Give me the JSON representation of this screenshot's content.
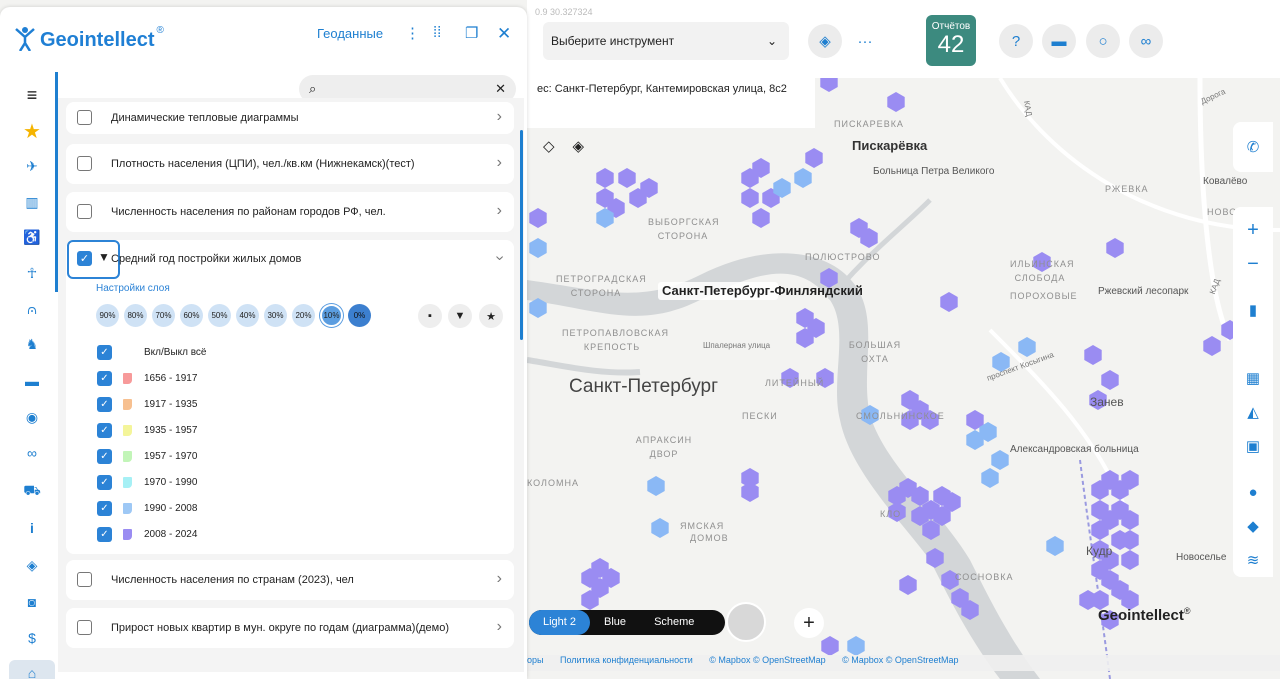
{
  "app": {
    "name": "Geointellect",
    "reg": "®",
    "geodata_label": "Геоданные"
  },
  "colors": {
    "accent": "#1e7fd0",
    "hex_purple": "#9a8cf2",
    "hex_blue": "#8ab8f5",
    "reports_bg": "#3c8a7f"
  },
  "map": {
    "coords_text": "0.9 30.327324",
    "tool_select": "Выберите инструмент",
    "address": "ес: Санкт-Петербург, Кантемировская улица, 8с2",
    "reports_label": "Отчётов",
    "reports_count": "42",
    "labels": {
      "piskarevka_upper": "ПИСКАРЕВКА",
      "piskarevka": "Пискарёвка",
      "hospital": "Больница Петра Великого",
      "kovalevo": "Ковалёво",
      "rzhevka": "РЖЕВКА",
      "novoe": "НОВОЕ",
      "vyborg_side": "ВЫБОРГСКАЯ СТОРОНА",
      "polyustrovo": "ПОЛЮСТРОВО",
      "ilinskaya": "ИЛЬИНСКАЯ СЛОБОДА",
      "porokhovye": "ПОРОХОВЫЕ",
      "rzhevsky_park": "Ржевский лесопарк",
      "petrograd": "ПЕТРОГРАДСКАЯ СТОРОНА",
      "station": "Санкт-Петербург-Финляндский",
      "bolshaya_okhta": "БОЛЬШАЯ ОХТА",
      "shpalernaya": "Шпалерная улица",
      "kosygina": "проспект Косыгина",
      "fortress": "ПЕТРОПАВЛОВСКАЯ КРЕПОСТЬ",
      "spb": "Санкт-Петербург",
      "liteyny": "ЛИТЕЙНЫЙ",
      "peski": "ПЕСКИ",
      "smolny": "СМОЛЬНИНСКОЕ",
      "apraksin": "АПРАКСИН ДВОР",
      "alexandrovsky": "Александровская больница",
      "zanevka": "Занев",
      "kolomna": "КОЛОМНА",
      "yamskaya": "ЯМСКАЯ",
      "doma": "ДОМОВ",
      "klo": "КЛО",
      "kudrovo": "Кудр",
      "sosnovka": "СОСНОВКА",
      "novoselye": "Новосельe",
      "dorogam": "Дорога",
      "kad": "КАД"
    },
    "styles": [
      {
        "label": "Light 2",
        "active": true
      },
      {
        "label": "Blue",
        "active": false
      },
      {
        "label": "Scheme",
        "active": false
      }
    ],
    "watermark": "Geointellect",
    "watermark_reg": "®",
    "footer": [
      "оры",
      "Политика конфиденциальности",
      "© Mapbox © OpenStreetMap",
      "© Mapbox © OpenStreetMap"
    ]
  },
  "panel": {
    "search_placeholder": "",
    "layers": [
      {
        "title": "Динамические тепловые диаграммы",
        "checked": false
      },
      {
        "title": "Плотность населения (ЦПИ), чел./кв.км (Нижнекамск)(тест)",
        "checked": false
      },
      {
        "title": "Численность населения по районам городов РФ, чел.",
        "checked": false
      },
      {
        "title": "Средний год постройки жилых домов",
        "checked": true
      },
      {
        "title": "Численность населения по странам (2023), чел",
        "checked": false
      },
      {
        "title": "Прирост новых квартир в мун. округе по годам (диаграмма)(демо)",
        "checked": false
      }
    ],
    "layer_settings": "Настройки слоя",
    "opacity_options": [
      "90%",
      "80%",
      "70%",
      "60%",
      "50%",
      "40%",
      "30%",
      "20%",
      "10%",
      "0%"
    ],
    "opacity_selected": "10%",
    "toggle_all": "Вкл/Выкл всё",
    "legend": [
      {
        "label": "1656 - 1917",
        "color": "#f79a9a"
      },
      {
        "label": "1917 - 1935",
        "color": "#f7c090"
      },
      {
        "label": "1935 - 1957",
        "color": "#f4f59a"
      },
      {
        "label": "1957 - 1970",
        "color": "#c2f5b8"
      },
      {
        "label": "1970 - 1990",
        "color": "#a6f0f5"
      },
      {
        "label": "1990 - 2008",
        "color": "#9ec8f5"
      },
      {
        "label": "2008 - 2024",
        "color": "#9a8cf2"
      }
    ]
  }
}
